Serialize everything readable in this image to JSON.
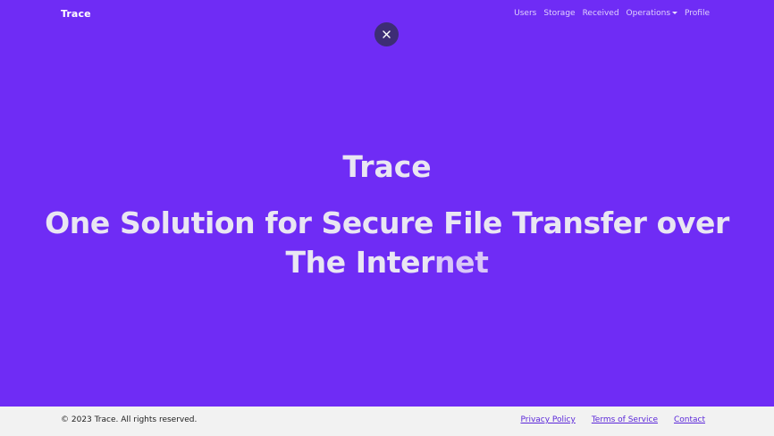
{
  "navbar": {
    "brand": "Trace",
    "links": [
      {
        "label": "Users"
      },
      {
        "label": "Storage"
      },
      {
        "label": "Received"
      },
      {
        "label": "Operations",
        "has_dropdown": true
      },
      {
        "label": "Profile"
      }
    ]
  },
  "close_button": {
    "icon": "close-icon"
  },
  "hero": {
    "title": "Trace",
    "subtitle_main": "One Solution for Secure File Transfer over The Inter",
    "subtitle_tail": "net"
  },
  "footer": {
    "copyright": "© 2023 Trace. All rights reserved.",
    "links": [
      {
        "label": "Privacy Policy"
      },
      {
        "label": "Terms of Service"
      },
      {
        "label": "Contact"
      }
    ]
  },
  "colors": {
    "background": "#6f2cf5",
    "close_button_bg": "#3d2d75",
    "hero_text": "#e9e6f2",
    "footer_bg": "#f2f2f2",
    "footer_link": "#5b27d9"
  }
}
